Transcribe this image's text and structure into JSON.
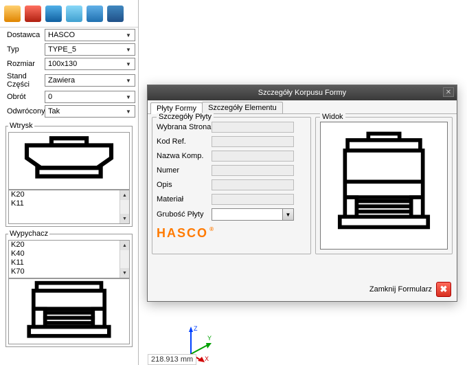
{
  "toolbar": {
    "icons": [
      "cup-icon",
      "pin-icon",
      "books-icon",
      "glasses-icon",
      "globe-icon",
      "block-icon"
    ]
  },
  "fields": {
    "dostawca": {
      "label": "Dostawca",
      "value": "HASCO"
    },
    "typ": {
      "label": "Typ",
      "value": "TYPE_5"
    },
    "rozmiar": {
      "label": "Rozmiar",
      "value": "100x130"
    },
    "stand": {
      "label": "Stand Części",
      "value": "Zawiera"
    },
    "obrot": {
      "label": "Obrót",
      "value": "0"
    },
    "odwrocony": {
      "label": "Odwrócony",
      "value": "Tak"
    }
  },
  "wtrysk": {
    "legend": "Wtrysk",
    "items": [
      "K20",
      "K11"
    ]
  },
  "wypychacz": {
    "legend": "Wypychacz",
    "items": [
      "K20",
      "K40",
      "K11",
      "K70"
    ]
  },
  "dialog": {
    "title": "Szczegóły Korpusu Formy",
    "tabs": {
      "plyty": "Płyty Formy",
      "element": "Szczegóły Elementu"
    },
    "details": {
      "box_title": "Szczegóły Płyty",
      "wybrana": {
        "label": "Wybrana Strona",
        "value": ""
      },
      "kodref": {
        "label": "Kod Ref.",
        "value": ""
      },
      "nazwa": {
        "label": "Nazwa Komp.",
        "value": ""
      },
      "numer": {
        "label": "Numer",
        "value": ""
      },
      "opis": {
        "label": "Opis",
        "value": ""
      },
      "material": {
        "label": "Materiał",
        "value": ""
      },
      "grubosc": {
        "label": "Grubość Płyty",
        "value": ""
      }
    },
    "preview": {
      "box_title": "Widok"
    },
    "brand": "HASCO",
    "close_text": "Zamknij Formularz"
  },
  "gizmo": {
    "x": "X",
    "y": "Y",
    "z": "Z"
  },
  "readout": "218.913 mm"
}
